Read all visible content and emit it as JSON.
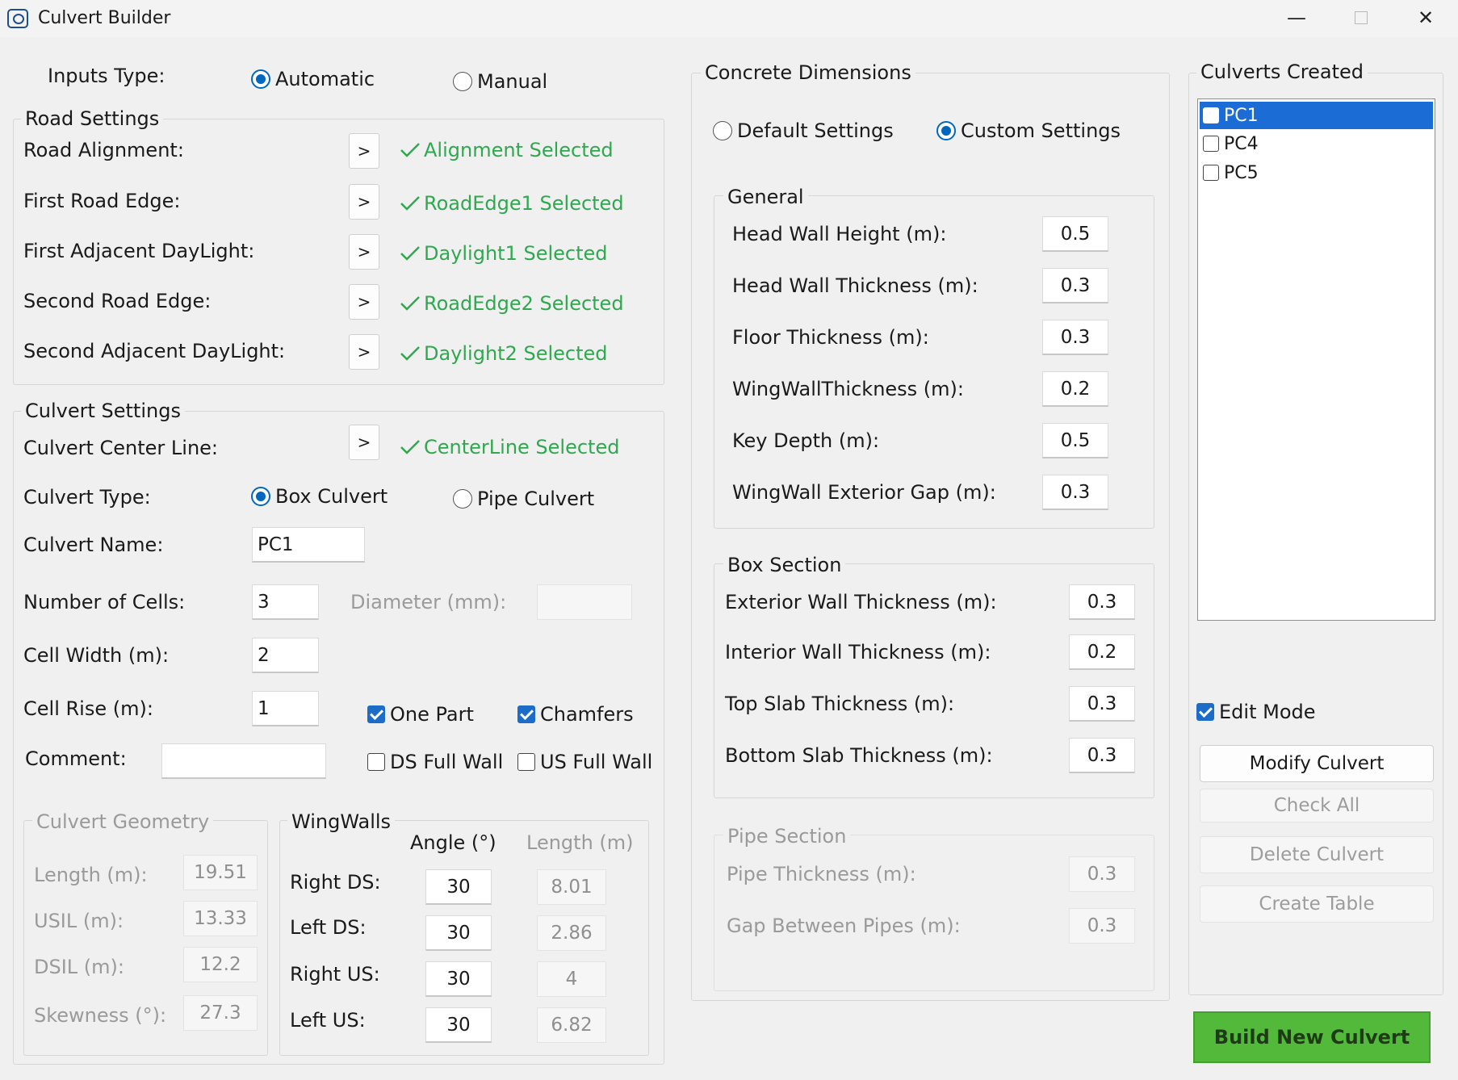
{
  "window": {
    "title": "Culvert Builder",
    "minimize_glyph": "—",
    "close_glyph": "✕"
  },
  "colors": {
    "accent_blue": "#0067c0",
    "selected_green": "#2fa84f",
    "build_button_green": "#53b93a"
  },
  "icons": {
    "selected": "checkmark-icon",
    "select_button": ">"
  },
  "inputs_type": {
    "label": "Inputs Type:",
    "options": [
      "Automatic",
      "Manual"
    ],
    "selected": "Automatic"
  },
  "road_settings": {
    "title": "Road Settings",
    "rows": [
      {
        "label": "Road Alignment:",
        "button": ">",
        "status": "Alignment Selected"
      },
      {
        "label": "First Road Edge:",
        "button": ">",
        "status": "RoadEdge1 Selected"
      },
      {
        "label": "First Adjacent DayLight:",
        "button": ">",
        "status": "Daylight1 Selected"
      },
      {
        "label": "Second Road Edge:",
        "button": ">",
        "status": "RoadEdge2 Selected"
      },
      {
        "label": "Second Adjacent DayLight:",
        "button": ">",
        "status": "Daylight2 Selected"
      }
    ]
  },
  "culvert_settings": {
    "title": "Culvert Settings",
    "center_line": {
      "label": "Culvert Center Line:",
      "button": ">",
      "status": "CenterLine Selected"
    },
    "culvert_type": {
      "label": "Culvert Type:",
      "options": [
        "Box Culvert",
        "Pipe Culvert"
      ],
      "selected": "Box Culvert"
    },
    "culvert_name": {
      "label": "Culvert Name:",
      "value": "PC1"
    },
    "number_of_cells": {
      "label": "Number of Cells:",
      "value": "3"
    },
    "diameter": {
      "label": "Diameter (mm):",
      "value": ""
    },
    "cell_width": {
      "label": "Cell Width (m):",
      "value": "2"
    },
    "cell_rise": {
      "label": "Cell Rise (m):",
      "value": "1"
    },
    "comment": {
      "label": "Comment:",
      "value": ""
    },
    "options": {
      "one_part": {
        "label": "One Part",
        "checked": true
      },
      "chamfers": {
        "label": "Chamfers",
        "checked": true
      },
      "ds_full_wall": {
        "label": "DS Full Wall",
        "checked": false
      },
      "us_full_wall": {
        "label": "US Full Wall",
        "checked": false
      }
    }
  },
  "culvert_geometry": {
    "title": "Culvert Geometry",
    "rows": [
      {
        "label": "Length (m):",
        "value": "19.51"
      },
      {
        "label": "USIL (m):",
        "value": "13.33"
      },
      {
        "label": "DSIL (m):",
        "value": "12.2"
      },
      {
        "label": "Skewness (°):",
        "value": "27.3"
      }
    ]
  },
  "wingwalls": {
    "title": "WingWalls",
    "headers": {
      "angle": "Angle (°)",
      "length": "Length (m)"
    },
    "rows": [
      {
        "label": "Right DS:",
        "angle": "30",
        "length": "8.01"
      },
      {
        "label": "Left DS:",
        "angle": "30",
        "length": "2.86"
      },
      {
        "label": "Right US:",
        "angle": "30",
        "length": "4"
      },
      {
        "label": "Left US:",
        "angle": "30",
        "length": "6.82"
      }
    ]
  },
  "concrete_dimensions": {
    "title": "Concrete Dimensions",
    "settings_options": [
      "Default Settings",
      "Custom Settings"
    ],
    "selected": "Custom Settings",
    "general": {
      "title": "General",
      "rows": [
        {
          "label": "Head Wall Height (m):",
          "value": "0.5"
        },
        {
          "label": "Head Wall Thickness (m):",
          "value": "0.3"
        },
        {
          "label": "Floor Thickness (m):",
          "value": "0.3"
        },
        {
          "label": "WingWallThickness (m):",
          "value": "0.2"
        },
        {
          "label": "Key Depth (m):",
          "value": "0.5"
        },
        {
          "label": "WingWall Exterior Gap (m):",
          "value": "0.3"
        }
      ]
    },
    "box_section": {
      "title": "Box Section",
      "rows": [
        {
          "label": "Exterior Wall Thickness (m):",
          "value": "0.3"
        },
        {
          "label": "Interior Wall Thickness (m):",
          "value": "0.2"
        },
        {
          "label": "Top Slab Thickness (m):",
          "value": "0.3"
        },
        {
          "label": "Bottom Slab Thickness (m):",
          "value": "0.3"
        }
      ]
    },
    "pipe_section": {
      "title": "Pipe Section",
      "rows": [
        {
          "label": "Pipe Thickness (m):",
          "value": "0.3"
        },
        {
          "label": "Gap Between Pipes (m):",
          "value": "0.3"
        }
      ]
    }
  },
  "culverts_created": {
    "title": "Culverts Created",
    "items": [
      {
        "label": "PC1",
        "selected": true,
        "checked": false
      },
      {
        "label": "PC4",
        "selected": false,
        "checked": false
      },
      {
        "label": "PC5",
        "selected": false,
        "checked": false
      }
    ],
    "edit_mode": {
      "label": "Edit Mode",
      "checked": true
    },
    "buttons": {
      "modify": "Modify Culvert",
      "check_all": "Check All",
      "delete": "Delete Culvert",
      "create_table": "Create Table"
    },
    "build_button": "Build New Culvert"
  }
}
